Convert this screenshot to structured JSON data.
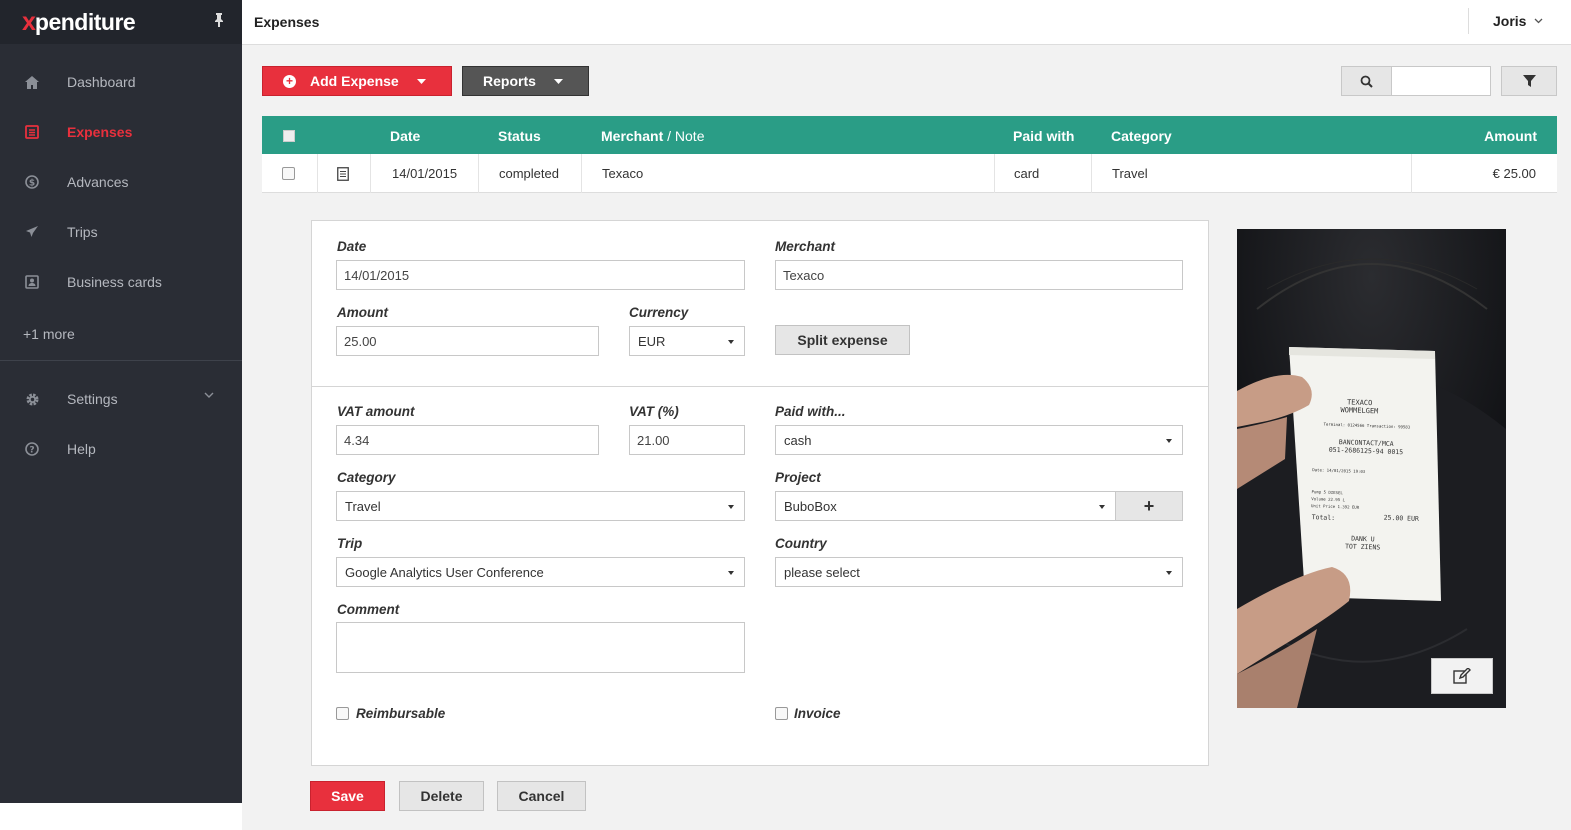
{
  "app": {
    "logo_x": "x",
    "logo_rest": "penditure"
  },
  "sidebar": {
    "items": [
      {
        "label": "Dashboard",
        "icon": "home-icon"
      },
      {
        "label": "Expenses",
        "icon": "receipt-icon",
        "active": true
      },
      {
        "label": "Advances",
        "icon": "dollar-circle-icon"
      },
      {
        "label": "Trips",
        "icon": "plane-icon"
      },
      {
        "label": "Business cards",
        "icon": "contact-card-icon"
      }
    ],
    "more": "+1 more",
    "settings": "Settings",
    "help": "Help"
  },
  "topbar": {
    "title": "Expenses",
    "user": "Joris"
  },
  "toolbar": {
    "add_expense": "Add Expense",
    "reports": "Reports",
    "search_value": ""
  },
  "table": {
    "headers": {
      "date": "Date",
      "status": "Status",
      "merchant": "Merchant",
      "note": "/ Note",
      "paid_with": "Paid with",
      "category": "Category",
      "amount": "Amount"
    },
    "rows": [
      {
        "date": "14/01/2015",
        "status": "completed",
        "merchant": "Texaco",
        "paid_with": "card",
        "category": "Travel",
        "amount": "€ 25.00"
      }
    ]
  },
  "form": {
    "labels": {
      "date": "Date",
      "merchant": "Merchant",
      "amount": "Amount",
      "currency": "Currency",
      "vat_amount": "VAT amount",
      "vat_pct": "VAT (%)",
      "paid_with": "Paid with...",
      "category": "Category",
      "project": "Project",
      "trip": "Trip",
      "country": "Country",
      "comment": "Comment",
      "reimbursable": "Reimbursable",
      "invoice": "Invoice"
    },
    "values": {
      "date": "14/01/2015",
      "merchant": "Texaco",
      "amount": "25.00",
      "currency": "EUR",
      "vat_amount": "4.34",
      "vat_pct": "21.00",
      "paid_with": "cash",
      "category": "Travel",
      "project": "BuboBox",
      "trip": "Google Analytics User Conference",
      "country": "please select",
      "comment": ""
    },
    "split_button": "Split expense",
    "plus_button": "+"
  },
  "receipt": {
    "line1": "TEXACO",
    "line2": "WOMMELGEM",
    "line3": "Terminal: 0124566   Transaction: 99583",
    "line4": "BANCONTACT/MCA",
    "line5": "051-2686125-94 0015",
    "line6": "Date: 14/01/2015 19:03",
    "line7": "Pump 5          DIESEL",
    "line8": "Volume          22.95 L",
    "line9": "Unit Price    1.392 EUR",
    "total_label": "Total:",
    "total_value": "25.00 EUR",
    "footer1": "DANK U",
    "footer2": "TOT ZIENS"
  },
  "actions": {
    "save": "Save",
    "delete": "Delete",
    "cancel": "Cancel"
  }
}
